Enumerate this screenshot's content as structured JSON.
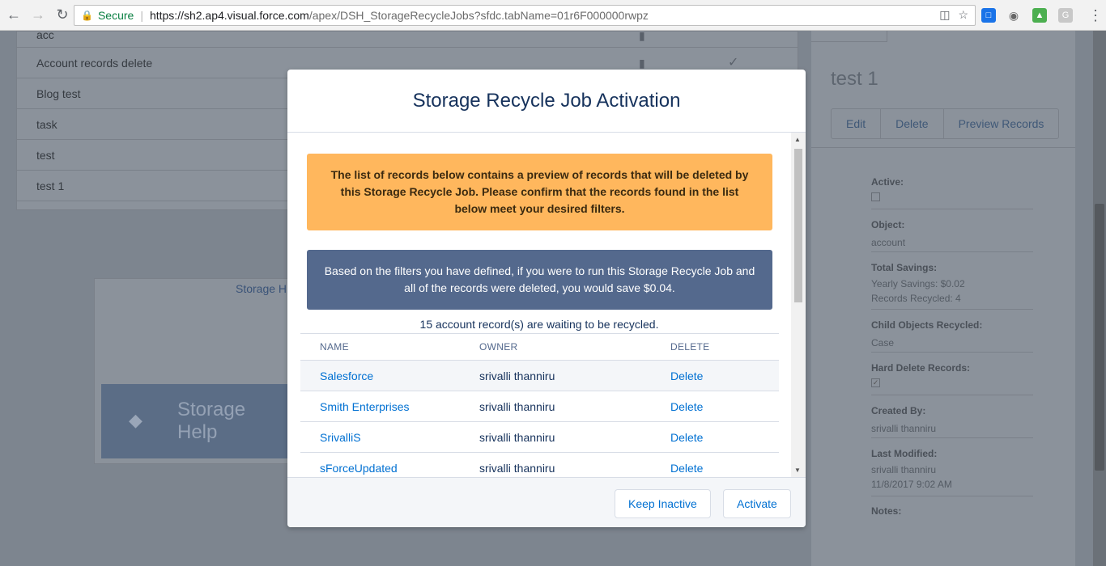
{
  "browser": {
    "secure_label": "Secure",
    "url_host": "https://sh2.ap4.visual.force.com",
    "url_path": "/apex/DSH_StorageRecycleJobs?sfdc.tabName=01r6F000000rwpz",
    "ext_g_label": "G"
  },
  "background": {
    "job_rows": [
      "acc",
      "Account records delete",
      "Blog test",
      "task",
      "test",
      "test 1"
    ],
    "helper_link": "Storage H",
    "helper_banner_text": "Storage Help"
  },
  "right_panel": {
    "title": "test 1",
    "buttons": [
      "Edit",
      "Delete",
      "Preview Records"
    ],
    "fields": {
      "active_label": "Active:",
      "object_label": "Object:",
      "object_value": "account",
      "savings_label": "Total Savings:",
      "savings_yearly": "Yearly Savings: $0.02",
      "savings_recycled": "Records Recycled: 4",
      "child_label": "Child Objects Recycled:",
      "child_value": "Case",
      "hard_delete_label": "Hard Delete Records:",
      "created_label": "Created By:",
      "created_value": "srivalli thanniru",
      "modified_label": "Last Modified:",
      "modified_by": "srivalli thanniru",
      "modified_date": "11/8/2017 9:02 AM",
      "notes_label": "Notes:"
    }
  },
  "modal": {
    "title": "Storage Recycle Job Activation",
    "warning": "The list of records below contains a preview of records that will be deleted by this Storage Recycle Job. Please confirm that the records found in the list below meet your desired filters.",
    "info": "Based on the filters you have defined, if you were to run this Storage Recycle Job and all of the records were deleted, you would save $0.04.",
    "count_text": "15 account record(s) are waiting to be recycled.",
    "table": {
      "headers": [
        "NAME",
        "OWNER",
        "DELETE"
      ],
      "rows": [
        {
          "name": "Salesforce",
          "owner": "srivalli thanniru",
          "action": "Delete"
        },
        {
          "name": "Smith Enterprises",
          "owner": "srivalli thanniru",
          "action": "Delete"
        },
        {
          "name": "SrivalliS",
          "owner": "srivalli thanniru",
          "action": "Delete"
        },
        {
          "name": "sForceUpdated",
          "owner": "srivalli thanniru",
          "action": "Delete"
        }
      ]
    },
    "keep_inactive_label": "Keep Inactive",
    "activate_label": "Activate"
  }
}
